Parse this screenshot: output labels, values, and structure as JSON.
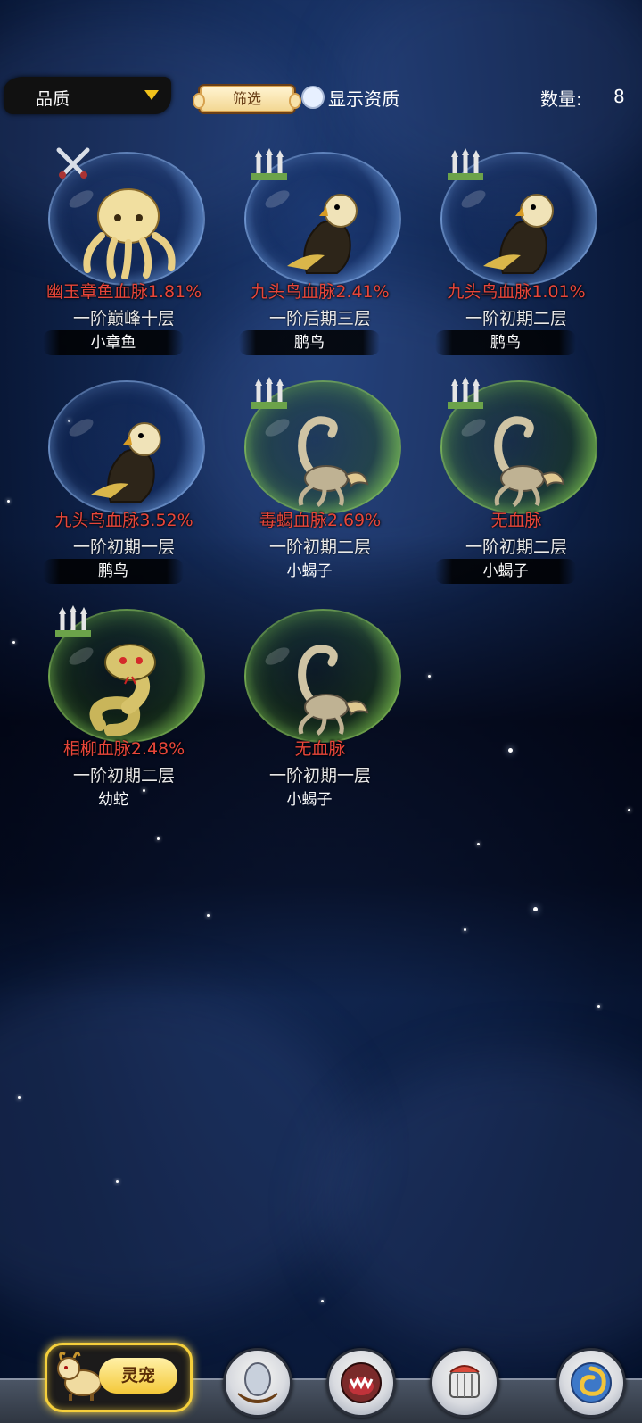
{
  "header": {
    "quality_label": "品质",
    "filter_label": "筛选",
    "show_aptitude_label": "显示资质",
    "count_label": "数量:",
    "count_value": "8"
  },
  "pets": [
    {
      "bloodline": "幽玉章鱼血脉1.81%",
      "realm": "一阶巅峰十层",
      "species": "小章鱼",
      "creature_icon": "octopus-icon",
      "rank_icon": "crossed-swords-icon",
      "bubble_color": "blue"
    },
    {
      "bloodline": "九头鸟血脉2.41%",
      "realm": "一阶后期三层",
      "species": "鹏鸟",
      "creature_icon": "eagle-icon",
      "rank_icon": "triple-arrow-rank-icon",
      "bubble_color": "blue"
    },
    {
      "bloodline": "九头鸟血脉1.01%",
      "realm": "一阶初期二层",
      "species": "鹏鸟",
      "creature_icon": "eagle-icon",
      "rank_icon": "triple-arrow-rank-icon",
      "bubble_color": "blue"
    },
    {
      "bloodline": "九头鸟血脉3.52%",
      "realm": "一阶初期一层",
      "species": "鹏鸟",
      "creature_icon": "eagle-icon",
      "rank_icon": "",
      "bubble_color": "blue"
    },
    {
      "bloodline": "毒蝎血脉2.69%",
      "realm": "一阶初期二层",
      "species": "小蝎子",
      "creature_icon": "scorpion-icon",
      "rank_icon": "triple-arrow-rank-icon",
      "bubble_color": "green"
    },
    {
      "bloodline": "无血脉",
      "realm": "一阶初期二层",
      "species": "小蝎子",
      "creature_icon": "scorpion-icon",
      "rank_icon": "triple-arrow-rank-icon",
      "bubble_color": "green"
    },
    {
      "bloodline": "相柳血脉2.48%",
      "realm": "一阶初期二层",
      "species": "幼蛇",
      "creature_icon": "snake-icon",
      "rank_icon": "triple-arrow-rank-icon",
      "bubble_color": "green"
    },
    {
      "bloodline": "无血脉",
      "realm": "一阶初期一层",
      "species": "小蝎子",
      "creature_icon": "scorpion-icon",
      "rank_icon": "",
      "bubble_color": "green"
    }
  ],
  "bottom_nav": {
    "active_label": "灵宠",
    "items": [
      "pet-ox-icon",
      "egg-nest-icon",
      "monster-mouth-icon",
      "cage-icon",
      "swirl-icon"
    ]
  },
  "colors": {
    "bloodline_text": "#e8463a",
    "accent_gold": "#f5cf3b"
  }
}
